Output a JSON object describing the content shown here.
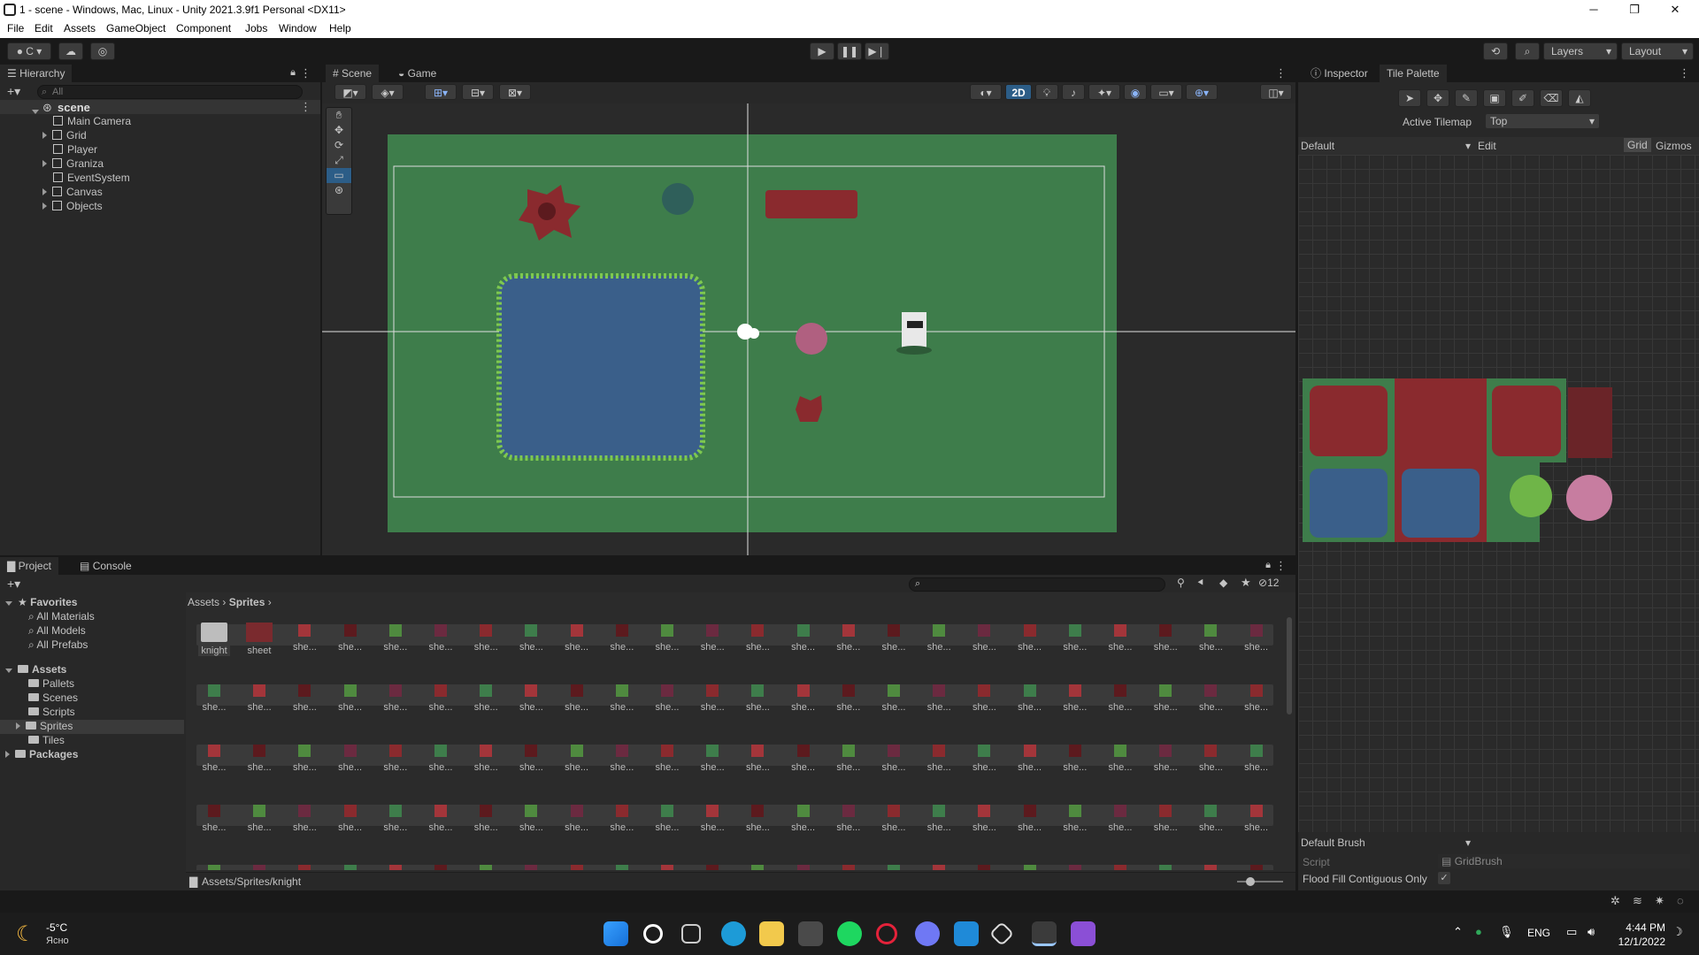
{
  "window": {
    "title": "1 - scene - Windows, Mac, Linux - Unity 2021.3.9f1 Personal <DX11>",
    "min": "─",
    "max": "❐",
    "close": "✕"
  },
  "menu": [
    "File",
    "Edit",
    "Assets",
    "GameObject",
    "Component",
    "Jobs",
    "Window",
    "Help"
  ],
  "toolbar": {
    "account": "C",
    "layers": "Layers",
    "layout": "Layout"
  },
  "hierarchy": {
    "tab": "Hierarchy",
    "search_placeholder": "All",
    "scene": "scene",
    "items": [
      "Main Camera",
      "Grid",
      "Player",
      "Graniza",
      "EventSystem",
      "Canvas",
      "Objects"
    ]
  },
  "scene_view": {
    "tabs": [
      "Scene",
      "Game"
    ],
    "mode_2d": "2D"
  },
  "inspector": {
    "tabs": [
      "Inspector",
      "Tile Palette"
    ],
    "active_tilemap_label": "Active Tilemap",
    "active_tilemap_value": "Top",
    "palette": "Default",
    "edit": "Edit",
    "grid": "Grid",
    "gizmos": "Gizmos",
    "brush": "Default Brush",
    "script_label": "Script",
    "script_value": "GridBrush",
    "flood_fill_label": "Flood Fill Contiguous Only",
    "flood_fill_checked": "✓"
  },
  "project": {
    "tabs": [
      "Project",
      "Console"
    ],
    "hidden_count": "12",
    "breadcrumb": [
      "Assets",
      "Sprites"
    ],
    "favorites": {
      "label": "Favorites",
      "items": [
        "All Materials",
        "All Models",
        "All Prefabs"
      ]
    },
    "assets": {
      "label": "Assets",
      "items": [
        "Pallets",
        "Scenes",
        "Scripts",
        "Sprites",
        "Tiles"
      ]
    },
    "packages": "Packages",
    "first_items": [
      "knight",
      "sheet"
    ],
    "sprite_label": "she...",
    "footer_path": "Assets/Sprites/knight"
  },
  "taskbar": {
    "weather_temp": "-5°C",
    "weather_text": "Ясно",
    "lang": "ENG",
    "time": "4:44 PM",
    "date": "12/1/2022"
  },
  "colors": {
    "accent": "#2c5d87",
    "grass": "#3e7d4b",
    "water": "#3a5f8a",
    "brick": "#7a2a2e"
  }
}
